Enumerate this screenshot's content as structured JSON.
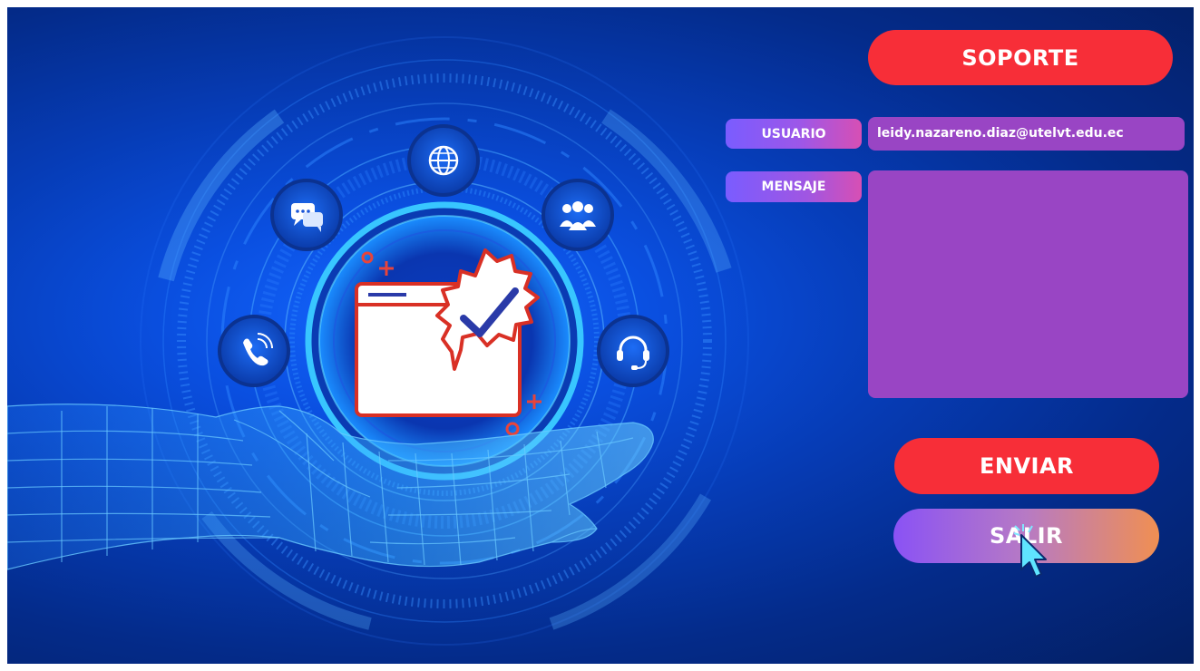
{
  "header": {
    "title": "SOPORTE"
  },
  "form": {
    "usuario_label": "USUARIO",
    "usuario_value": "leidy.nazareno.diaz@utelvt.edu.ec",
    "mensaje_label": "MENSAJE",
    "mensaje_value": ""
  },
  "actions": {
    "enviar_label": "ENVIAR",
    "salir_label": "SALIR"
  },
  "illustration": {
    "icons": [
      "globe-icon",
      "chat-icon",
      "group-icon",
      "phone-icon",
      "headset-icon",
      "verified-folder-icon",
      "robotic-hand"
    ]
  },
  "colors": {
    "accent_red": "#f72e38",
    "field_purple": "#9945c4",
    "background_blue": "#0a4fe0",
    "salir_gradient_start": "#8a52f5",
    "salir_gradient_end": "#f08f52"
  }
}
